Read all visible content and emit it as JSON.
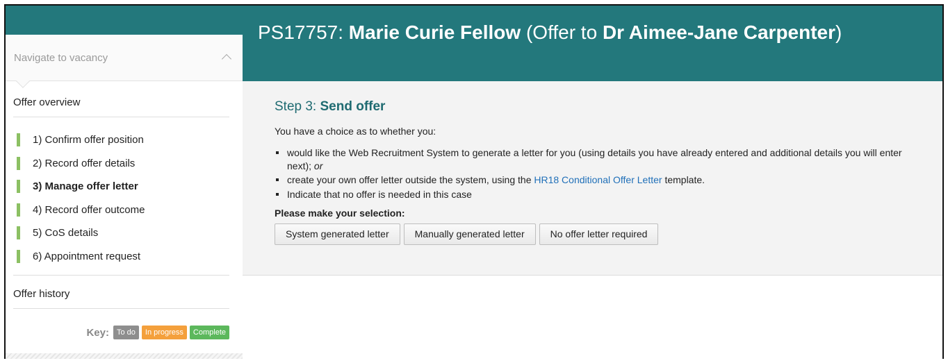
{
  "header": {
    "ref": "PS17757:",
    "post_title": "Marie Curie Fellow",
    "offer_prefix": "(Offer to ",
    "candidate": "Dr Aimee-Jane Carpenter",
    "offer_suffix": ")"
  },
  "sidebar": {
    "nav_vacancy": "Navigate to vacancy",
    "offer_overview": "Offer overview",
    "steps": [
      {
        "label": "1) Confirm offer position",
        "status": "complete"
      },
      {
        "label": "2) Record offer details",
        "status": "complete"
      },
      {
        "label": "3) Manage offer letter",
        "status": "complete",
        "active": true
      },
      {
        "label": "4) Record offer outcome",
        "status": "complete"
      },
      {
        "label": "5) CoS details",
        "status": "complete"
      },
      {
        "label": "6) Appointment request",
        "status": "complete"
      }
    ],
    "offer_history": "Offer history",
    "key": {
      "label": "Key:",
      "todo": "To do",
      "in_progress": "In progress",
      "complete": "Complete"
    }
  },
  "step": {
    "title_prefix": "Step 3: ",
    "title": "Send offer",
    "intro": "You have a choice as to whether you:",
    "choice1_text": "would like the Web Recruitment System to generate a letter for you (using details you have already entered and additional details you will enter next); ",
    "choice1_or": "or",
    "choice2_before": "create your own offer letter outside the system, using the ",
    "choice2_link": "HR18 Conditional Offer Letter",
    "choice2_after": " template.",
    "choice3": "Indicate that no offer is needed in this case",
    "selection_label": "Please make your selection:"
  },
  "buttons": {
    "system": "System generated letter",
    "manual": "Manually generated letter",
    "none": "No offer letter required"
  },
  "colors": {
    "teal": "#23787c",
    "step_bar": "#8cc063",
    "todo": "#8e8e8e",
    "in_progress": "#f4a03c",
    "complete": "#5cb85c",
    "link": "#1f6fb8"
  }
}
